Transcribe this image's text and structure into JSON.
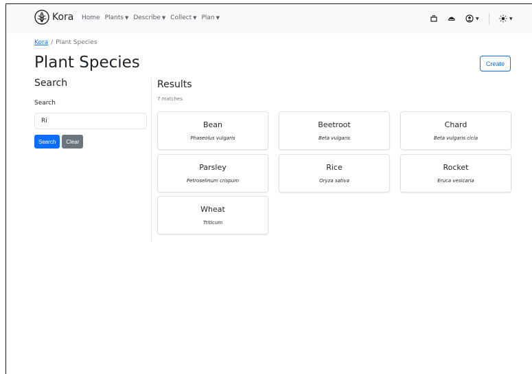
{
  "navbar": {
    "brand": "Kora",
    "links": [
      {
        "label": "Home",
        "dropdown": false
      },
      {
        "label": "Plants",
        "dropdown": true
      },
      {
        "label": "Describe",
        "dropdown": true
      },
      {
        "label": "Collect",
        "dropdown": true
      },
      {
        "label": "Plan",
        "dropdown": true
      }
    ],
    "icons": [
      "seed-tray-icon",
      "cloud-icon",
      "user-icon",
      "sun-icon"
    ]
  },
  "breadcrumb": {
    "root": "Kora",
    "separator": "/",
    "current": "Plant Species"
  },
  "page_title": "Plant Species",
  "create_label": "Create",
  "sidebar": {
    "heading": "Search",
    "label": "Search",
    "input_value": "Ri",
    "search_button": "Search",
    "clear_button": "Clear"
  },
  "results": {
    "heading": "Results",
    "count_text": "7 matches.",
    "items": [
      {
        "name": "Bean",
        "latin": "Phaseolus vulgaris"
      },
      {
        "name": "Beetroot",
        "latin": "Beta vulgaris"
      },
      {
        "name": "Chard",
        "latin": "Beta vulgaris cicla"
      },
      {
        "name": "Parsley",
        "latin": "Petroselinum crispum"
      },
      {
        "name": "Rice",
        "latin": "Oryza sativa"
      },
      {
        "name": "Rocket",
        "latin": "Eruca vesicaria"
      },
      {
        "name": "Wheat",
        "latin": "Triticum"
      }
    ]
  },
  "colors": {
    "primary": "#0d6efd",
    "secondary": "#6c757d",
    "navbar_bg": "#f8f9fa"
  }
}
